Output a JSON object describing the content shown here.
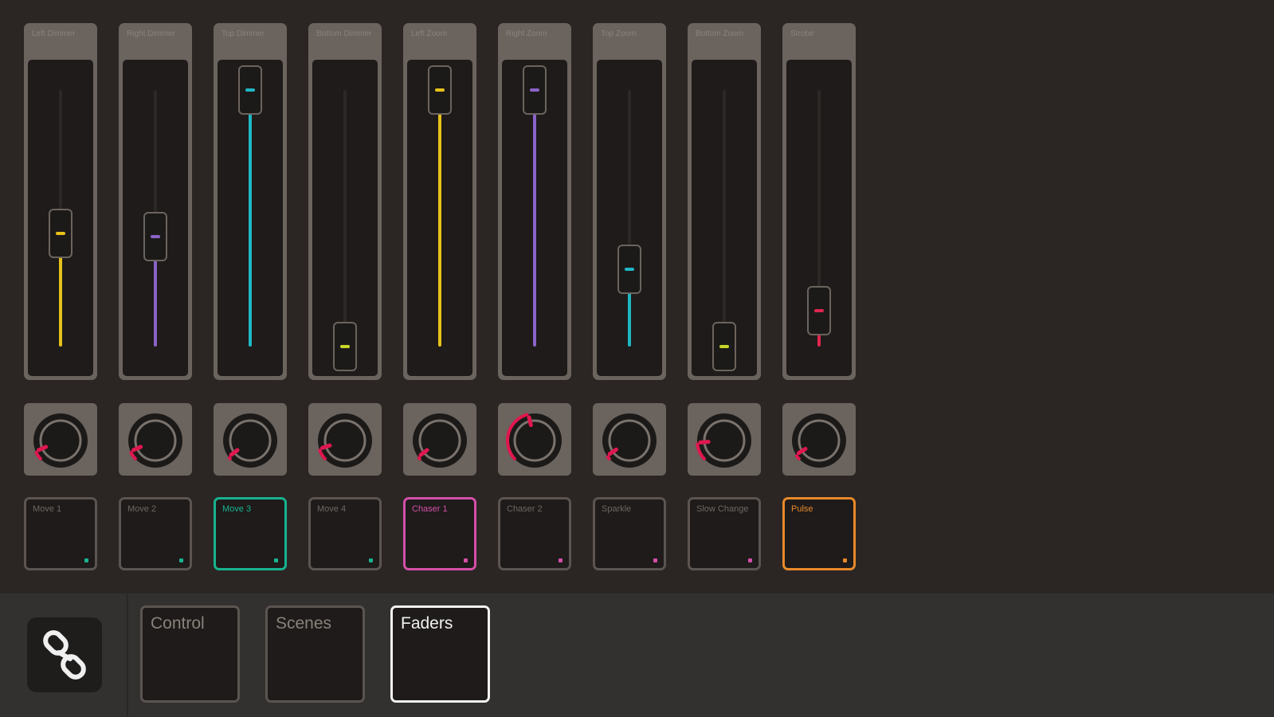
{
  "faders": [
    {
      "label": "Left Dimmer",
      "value": 0.44,
      "color": "#e6c21a"
    },
    {
      "label": "Right Dimmer",
      "value": 0.43,
      "color": "#8a63c8"
    },
    {
      "label": "Top Dimmer",
      "value": 1.0,
      "color": "#1fb7c4"
    },
    {
      "label": "Bottom Dimmer",
      "value": 0.0,
      "color": "#c8d62a"
    },
    {
      "label": "Left Zoom",
      "value": 1.0,
      "color": "#e6c21a"
    },
    {
      "label": "Right Zoom",
      "value": 1.0,
      "color": "#8a63c8"
    },
    {
      "label": "Top Zoom",
      "value": 0.3,
      "color": "#1fb7c4"
    },
    {
      "label": "Bottom Zoom",
      "value": 0.0,
      "color": "#c8d62a"
    },
    {
      "label": "Strobe",
      "value": 0.14,
      "color": "#e0264f"
    }
  ],
  "knobs": [
    {
      "value": 0.08
    },
    {
      "value": 0.08
    },
    {
      "value": 0.03
    },
    {
      "value": 0.1
    },
    {
      "value": 0.03
    },
    {
      "value": 0.45
    },
    {
      "value": 0.04
    },
    {
      "value": 0.15
    },
    {
      "value": 0.05
    }
  ],
  "knob_color": "#e0174f",
  "pads": [
    {
      "label": "Move 1",
      "accent": "#17b38f",
      "active": false
    },
    {
      "label": "Move 2",
      "accent": "#17b38f",
      "active": false
    },
    {
      "label": "Move 3",
      "accent": "#17b38f",
      "active": true
    },
    {
      "label": "Move 4",
      "accent": "#17b38f",
      "active": false
    },
    {
      "label": "Chaser 1",
      "accent": "#d44fa8",
      "active": true
    },
    {
      "label": "Chaser 2",
      "accent": "#d44fa8",
      "active": false
    },
    {
      "label": "Sparkle",
      "accent": "#d44fa8",
      "active": false
    },
    {
      "label": "Slow Change",
      "accent": "#d44fa8",
      "active": false
    },
    {
      "label": "Pulse",
      "accent": "#e8892a",
      "active": true
    }
  ],
  "bottom": {
    "link_icon": "link-icon",
    "tabs": [
      {
        "label": "Control",
        "active": false
      },
      {
        "label": "Scenes",
        "active": false
      },
      {
        "label": "Faders",
        "active": true
      }
    ]
  }
}
